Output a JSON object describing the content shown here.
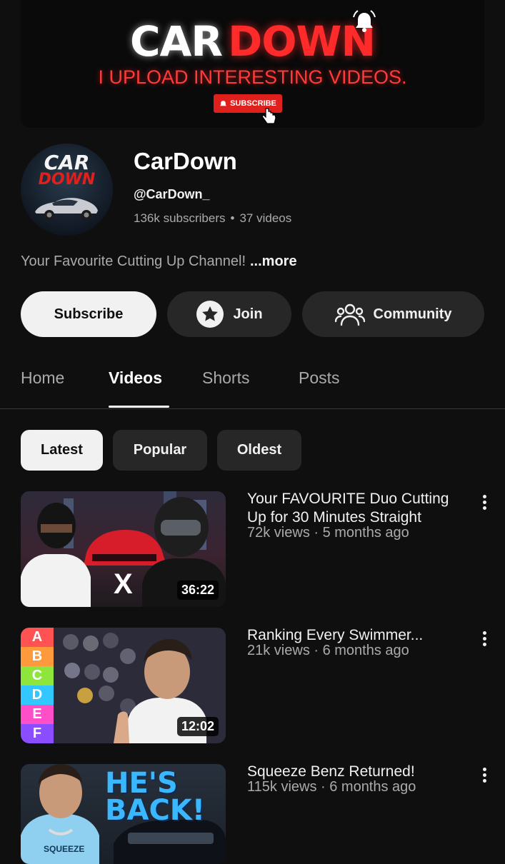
{
  "banner": {
    "title_white": "CAR",
    "title_red": "DOWN",
    "tagline": "I UPLOAD INTERESTING VIDEOS.",
    "subscribe_badge": "SUBSCRIBE"
  },
  "avatar": {
    "line1": "CAR",
    "line2": "DOWN"
  },
  "channel": {
    "name": "CarDown",
    "handle": "@CarDown_",
    "subscribers": "136k subscribers",
    "videos": "37 videos",
    "description": "Your Favourite Cutting Up Channel!",
    "more_label": "...more"
  },
  "actions": {
    "subscribe": "Subscribe",
    "join": "Join",
    "community": "Community"
  },
  "tabs": [
    {
      "label": "Home"
    },
    {
      "label": "Videos"
    },
    {
      "label": "Shorts"
    },
    {
      "label": "Posts"
    }
  ],
  "filters": [
    {
      "label": "Latest"
    },
    {
      "label": "Popular"
    },
    {
      "label": "Oldest"
    }
  ],
  "videos": [
    {
      "title": "Your FAVOURITE Duo Cutting Up for 30 Minutes Straight",
      "meta": "72k views · 5 months ago",
      "duration": "36:22",
      "overlay": "X"
    },
    {
      "title": "Ranking Every Swimmer...",
      "meta": "21k views · 6 months ago",
      "duration": "12:02",
      "tiers": [
        "A",
        "B",
        "C",
        "D",
        "E",
        "F"
      ]
    },
    {
      "title": "Squeeze Benz Returned!",
      "meta": "115k views · 6 months ago",
      "overlay_line1": "HE'S",
      "overlay_line2": "BACK!",
      "shirt_text": "SQUEEZE"
    }
  ],
  "colors": {
    "background": "#0f0f0f",
    "chip": "#272727",
    "brand_red": "#e0201c",
    "secondary_text": "#aaaaaa"
  }
}
